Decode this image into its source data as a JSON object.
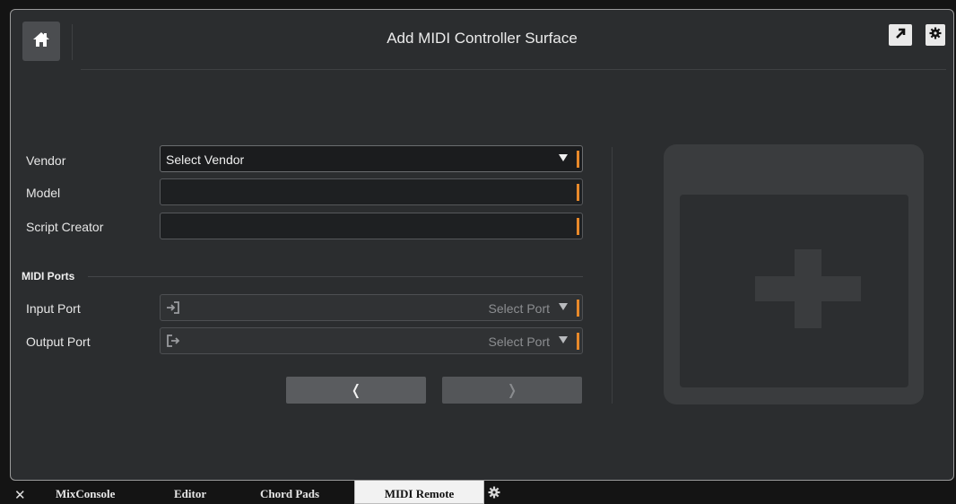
{
  "header": {
    "title": "Add MIDI Controller Surface",
    "home_icon": "home-icon",
    "popout_icon": "popout-arrow-icon",
    "settings_icon": "gear-icon"
  },
  "form": {
    "vendor": {
      "label": "Vendor",
      "value": "Select Vendor"
    },
    "model": {
      "label": "Model",
      "value": ""
    },
    "script_creator": {
      "label": "Script Creator",
      "value": ""
    },
    "midi_ports": {
      "title": "MIDI Ports",
      "input": {
        "label": "Input Port",
        "value": "Select Port",
        "icon": "input-port-icon"
      },
      "output": {
        "label": "Output Port",
        "value": "Select Port",
        "icon": "output-port-icon"
      }
    },
    "back_label": "❬",
    "next_label": "❭"
  },
  "preview": {
    "icon": "add-device-placeholder-icon"
  },
  "tabs": {
    "close_icon": "close-icon",
    "items": [
      "MixConsole",
      "Editor",
      "Chord Pads",
      "MIDI Remote"
    ],
    "active": "MIDI Remote",
    "settings_icon": "gear-icon"
  },
  "colors": {
    "accent": "#e8892a",
    "panel": "#2b2d2f",
    "background": "#141414"
  }
}
